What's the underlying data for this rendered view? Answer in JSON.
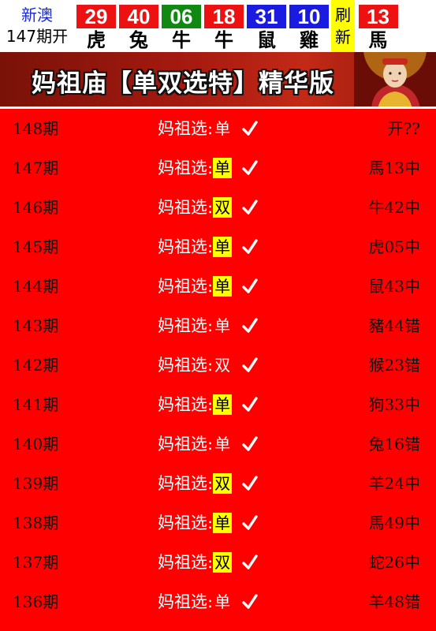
{
  "header": {
    "brand": "新澳",
    "issue": "147期开",
    "balls": [
      {
        "num": "29",
        "zodiac": "虎",
        "color": "#ee1111"
      },
      {
        "num": "40",
        "zodiac": "兔",
        "color": "#ee1111"
      },
      {
        "num": "06",
        "zodiac": "牛",
        "color": "#118811"
      },
      {
        "num": "18",
        "zodiac": "牛",
        "color": "#ee1111"
      },
      {
        "num": "31",
        "zodiac": "鼠",
        "color": "#1a1ae0"
      },
      {
        "num": "10",
        "zodiac": "雞",
        "color": "#1a1ae0"
      }
    ],
    "refresh": [
      "刷",
      "新"
    ],
    "special": {
      "num": "13",
      "zodiac": "馬",
      "color": "#ee1111"
    }
  },
  "banner": {
    "title": "妈祖庙【单双选特】精华版",
    "image_icon": "mazu-portrait"
  },
  "colors": {
    "page_background": "#ff0000",
    "highlight": "#ffff00",
    "label_text": "#ffffff"
  },
  "pick_label": "妈祖选:",
  "rows": [
    {
      "issue": "148期",
      "pick": "单",
      "highlight": false,
      "result": "开??"
    },
    {
      "issue": "147期",
      "pick": "单",
      "highlight": true,
      "result": "馬13中"
    },
    {
      "issue": "146期",
      "pick": "双",
      "highlight": true,
      "result": "牛42中"
    },
    {
      "issue": "145期",
      "pick": "单",
      "highlight": true,
      "result": "虎05中"
    },
    {
      "issue": "144期",
      "pick": "单",
      "highlight": true,
      "result": "鼠43中"
    },
    {
      "issue": "143期",
      "pick": "单",
      "highlight": false,
      "result": "豬44错"
    },
    {
      "issue": "142期",
      "pick": "双",
      "highlight": false,
      "result": "猴23错"
    },
    {
      "issue": "141期",
      "pick": "单",
      "highlight": true,
      "result": "狗33中"
    },
    {
      "issue": "140期",
      "pick": "单",
      "highlight": false,
      "result": "兔16错"
    },
    {
      "issue": "139期",
      "pick": "双",
      "highlight": true,
      "result": "羊24中"
    },
    {
      "issue": "138期",
      "pick": "单",
      "highlight": true,
      "result": "馬49中"
    },
    {
      "issue": "137期",
      "pick": "双",
      "highlight": true,
      "result": "蛇26中"
    },
    {
      "issue": "136期",
      "pick": "单",
      "highlight": false,
      "result": "羊48错"
    }
  ]
}
